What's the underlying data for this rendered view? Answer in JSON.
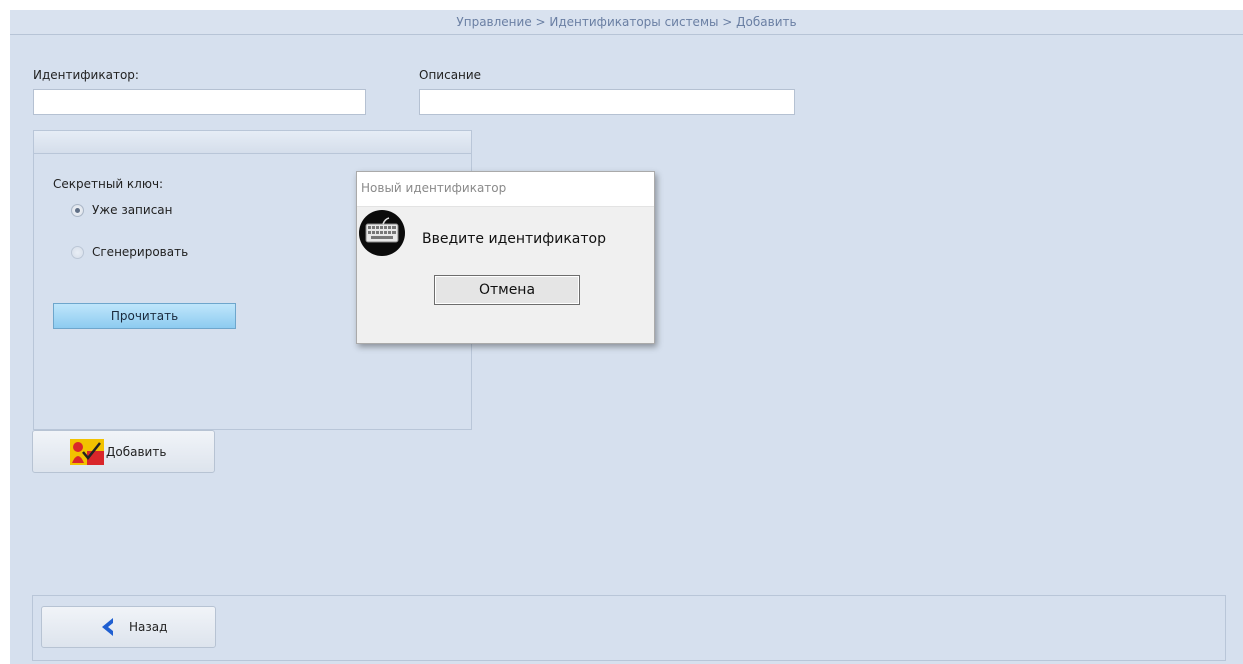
{
  "header": {
    "breadcrumb": "Управление > Идентификаторы системы > Добавить"
  },
  "form": {
    "identifier_label": "Идентификатор:",
    "identifier_value": "",
    "description_label": "Описание",
    "description_value": ""
  },
  "secret_key": {
    "label": "Секретный ключ:",
    "options": [
      {
        "label": "Уже записан",
        "selected": true
      },
      {
        "label": "Сгенерировать",
        "selected": false
      }
    ],
    "read_button": "Прочитать"
  },
  "actions": {
    "add_button": "Добавить",
    "back_button": "Назад"
  },
  "dialog": {
    "title": "Новый идентификатор",
    "message": "Введите идентификатор",
    "cancel_button": "Отмена",
    "icon": "keyboard-icon"
  },
  "colors": {
    "background": "#d6e0ee",
    "header_text": "#6a7fa3",
    "read_button": "#a8daf6",
    "back_arrow": "#1f5fd1"
  }
}
